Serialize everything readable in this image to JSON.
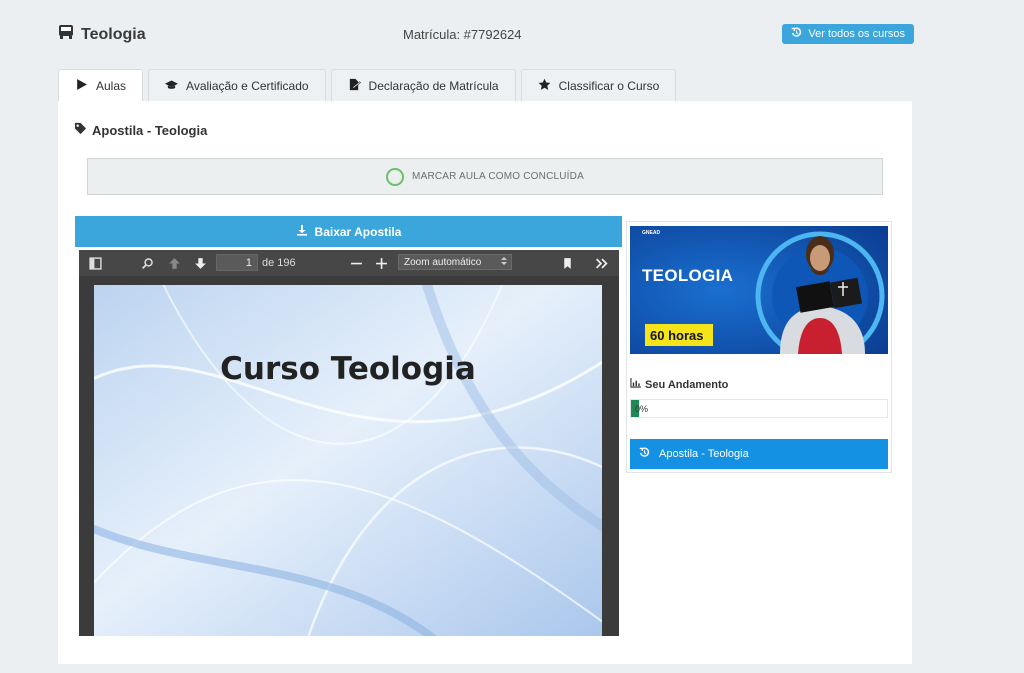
{
  "header": {
    "course_title": "Teologia",
    "enrollment": "Matrícula: #7792624",
    "all_courses_label": "Ver todos os cursos"
  },
  "tabs": [
    {
      "label": "Aulas",
      "icon": "play-icon",
      "active": true
    },
    {
      "label": "Avaliação e Certificado",
      "icon": "graduation-cap-icon",
      "active": false
    },
    {
      "label": "Declaração de Matrícula",
      "icon": "file-signature-icon",
      "active": false
    },
    {
      "label": "Classificar o Curso",
      "icon": "star-icon",
      "active": false
    }
  ],
  "lesson": {
    "title": "Apostila - Teologia",
    "mark_done_label": "MARCAR AULA COMO CONCLUÍDA",
    "download_label": "Baixar Apostila"
  },
  "pdf_viewer": {
    "current_page": "1",
    "total_pages": "de 196",
    "zoom": "Zoom automático",
    "page_heading": "Curso Teologia"
  },
  "sidebar": {
    "banner": {
      "brand": "GNEAD",
      "title": "TEOLOGIA",
      "hours": "60 horas"
    },
    "progress_title": "Seu Andamento",
    "progress_percent": 0,
    "progress_label": "0%",
    "lesson_item": "Apostila - Teologia"
  },
  "colors": {
    "accent": "#3aa6dc",
    "lesson_item": "#1591e3",
    "progress": "#1e8a55",
    "done_ring": "#6cc06a"
  }
}
